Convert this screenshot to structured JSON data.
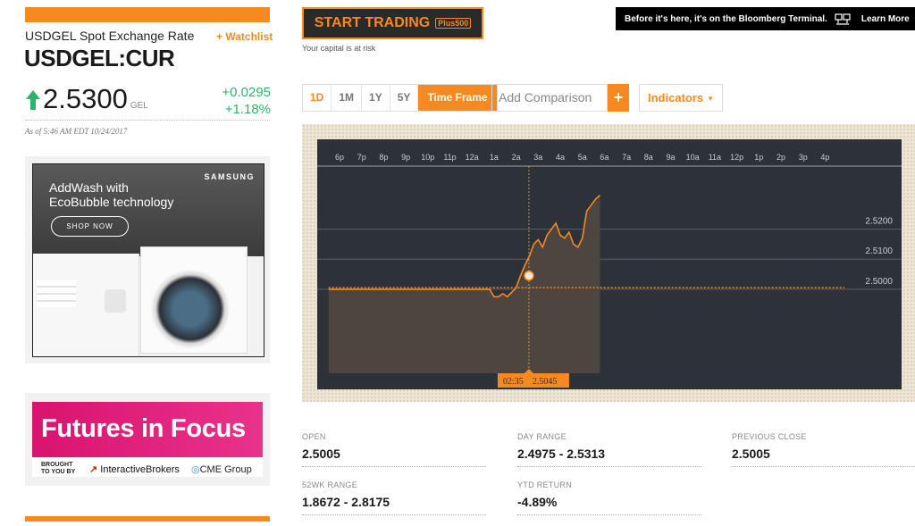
{
  "quote": {
    "name": "USDGEL Spot Exchange Rate",
    "watchlist_label": "+ Watchlist",
    "ticker": "USDGEL:CUR",
    "price": "2.5300",
    "currency": "GEL",
    "change_abs": "+0.0295",
    "change_pct": "+1.18%",
    "as_of": "As of 5:46 AM EDT 10/24/2017",
    "direction_icon": "arrow-up-icon",
    "up_color": "#2fb36b"
  },
  "ads": {
    "samsung": {
      "brand": "SAMSUNG",
      "headline_1": "AddWash with",
      "headline_2": "EcoBubble technology",
      "cta": "SHOP NOW"
    },
    "futures": {
      "title": "Futures in Focus",
      "brought_1": "BROUGHT",
      "brought_2": "TO YOU BY",
      "sponsor_1": "InteractiveBrokers",
      "sponsor_2": "CME Group"
    }
  },
  "trade": {
    "button_label": "START TRADING",
    "button_brand": "Plus500",
    "risk_note": "Your capital is at risk"
  },
  "banner": {
    "text": "Before it's here, it's on the Bloomberg Terminal.",
    "icon": "terminal-icon",
    "link": "Learn More"
  },
  "controls": {
    "ranges": [
      "1D",
      "1M",
      "1Y",
      "5Y"
    ],
    "active_range": "1D",
    "timeframe_label": "Time Frame",
    "compare_placeholder": "Add Comparison",
    "compare_plus": "+",
    "indicators_label": "Indicators"
  },
  "chart_data": {
    "type": "area",
    "x_ticks": [
      "6p",
      "7p",
      "8p",
      "9p",
      "10p",
      "11p",
      "12a",
      "1a",
      "2a",
      "3a",
      "4a",
      "5a",
      "6a",
      "7a",
      "8a",
      "9a",
      "10a",
      "11a",
      "12p",
      "1p",
      "2p",
      "3p",
      "4p"
    ],
    "y_ticks": [
      2.5,
      2.51,
      2.52
    ],
    "y_range": [
      2.472,
      2.541
    ],
    "prev_close": 2.5005,
    "series": [
      {
        "x": [
          -0.5,
          0,
          1,
          2,
          3,
          4,
          5,
          6,
          6.8,
          7.0,
          7.2,
          7.4,
          7.6,
          7.8,
          8.0,
          8.2,
          8.4,
          8.6,
          8.8,
          9.0,
          9.2,
          9.4,
          9.6,
          9.8,
          10.0,
          10.2,
          10.4,
          10.6,
          10.8,
          11.0,
          11.2,
          11.4,
          11.6,
          11.8
        ],
        "values": [
          2.5,
          2.5,
          2.5,
          2.5,
          2.5,
          2.5,
          2.5,
          2.5,
          2.5,
          2.4975,
          2.4975,
          2.4985,
          2.4975,
          2.499,
          2.5005,
          2.5045,
          2.508,
          2.511,
          2.515,
          2.5165,
          2.514,
          2.518,
          2.52,
          2.522,
          2.518,
          2.517,
          2.519,
          2.515,
          2.514,
          2.517,
          2.526,
          2.528,
          2.53,
          2.5313
        ]
      }
    ],
    "crosshair": {
      "time": "02:35",
      "value": "2.5045",
      "x": 8.58
    },
    "colors": {
      "line": "#f6891f",
      "area": "#4d4540",
      "plot_bg": "#2d3138",
      "grid": "#5a5f68"
    }
  },
  "stats": {
    "open_label": "OPEN",
    "open_value": "2.5005",
    "day_range_label": "DAY RANGE",
    "day_range_value": "2.4975 - 2.5313",
    "prev_close_label": "PREVIOUS CLOSE",
    "prev_close_value": "2.5005",
    "wk52_label": "52WK RANGE",
    "wk52_value": "1.8672 - 2.8175",
    "ytd_label": "YTD RETURN",
    "ytd_value": "-4.89%"
  }
}
